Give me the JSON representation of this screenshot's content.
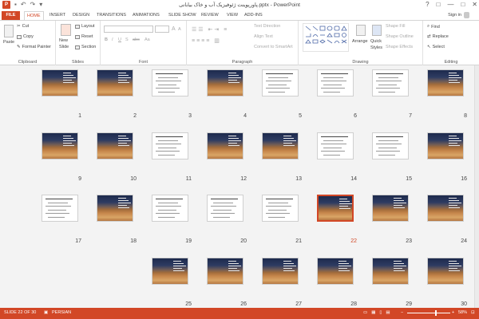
{
  "window": {
    "title": "پاورپوینت ژئوفیزیک آب و خاک بیابانی.pptx - PowerPoint",
    "controls": [
      "?",
      "□",
      "—",
      "□",
      "✕"
    ]
  },
  "quick_access": [
    "save-icon",
    "undo-icon",
    "redo-icon",
    "customize-icon"
  ],
  "tabs": [
    "FILE",
    "HOME",
    "INSERT",
    "DESIGN",
    "TRANSITIONS",
    "ANIMATIONS",
    "SLIDE SHOW",
    "REVIEW",
    "VIEW",
    "ADD-INS"
  ],
  "active_tab": "HOME",
  "account": {
    "sign_in": "Sign in"
  },
  "ribbon": {
    "clipboard": {
      "label": "Clipboard",
      "paste": "Paste",
      "cut": "Cut",
      "copy": "Copy",
      "format_painter": "Format Painter"
    },
    "slides": {
      "label": "Slides",
      "new_slide": "New",
      "new_slide_2": "Slide",
      "layout": "Layout",
      "reset": "Reset",
      "section": "Section"
    },
    "font": {
      "label": "Font",
      "bold": "B",
      "italic": "I",
      "underline": "U",
      "strike": "S",
      "spacing": "abc",
      "case": "Aa",
      "grow": "A",
      "shrink": "A"
    },
    "paragraph": {
      "label": "Paragraph",
      "text_direction": "Text Direction",
      "align_text": "Align Text",
      "convert_smartart": "Convert to SmartArt"
    },
    "drawing": {
      "label": "Drawing",
      "arrange": "Arrange",
      "quick_styles": "Quick",
      "quick_styles_2": "Styles",
      "shape_fill": "Shape Fill",
      "shape_outline": "Shape Outline",
      "shape_effects": "Shape Effects"
    },
    "editing": {
      "label": "Editing",
      "find": "Find",
      "replace": "Replace",
      "select": "Select"
    }
  },
  "slides": {
    "total": 30,
    "selected": 22,
    "rows": [
      [
        8,
        7,
        6,
        5,
        4,
        3,
        2,
        1
      ],
      [
        16,
        15,
        14,
        13,
        12,
        11,
        10,
        9
      ],
      [
        24,
        23,
        22,
        21,
        20,
        19,
        18,
        17
      ],
      [
        30,
        29,
        28,
        27,
        26,
        25
      ]
    ],
    "white_background": [
      3,
      5,
      6,
      7,
      11,
      14,
      15,
      17,
      19,
      20,
      21
    ],
    "title_slide_text": "ژئوفیزیک آب و خاک بیابانی"
  },
  "status_bar": {
    "slide_info": "SLIDE 22 OF 30",
    "language": "PERSIAN",
    "zoom": "58%"
  },
  "colors": {
    "accent": "#d24726"
  }
}
